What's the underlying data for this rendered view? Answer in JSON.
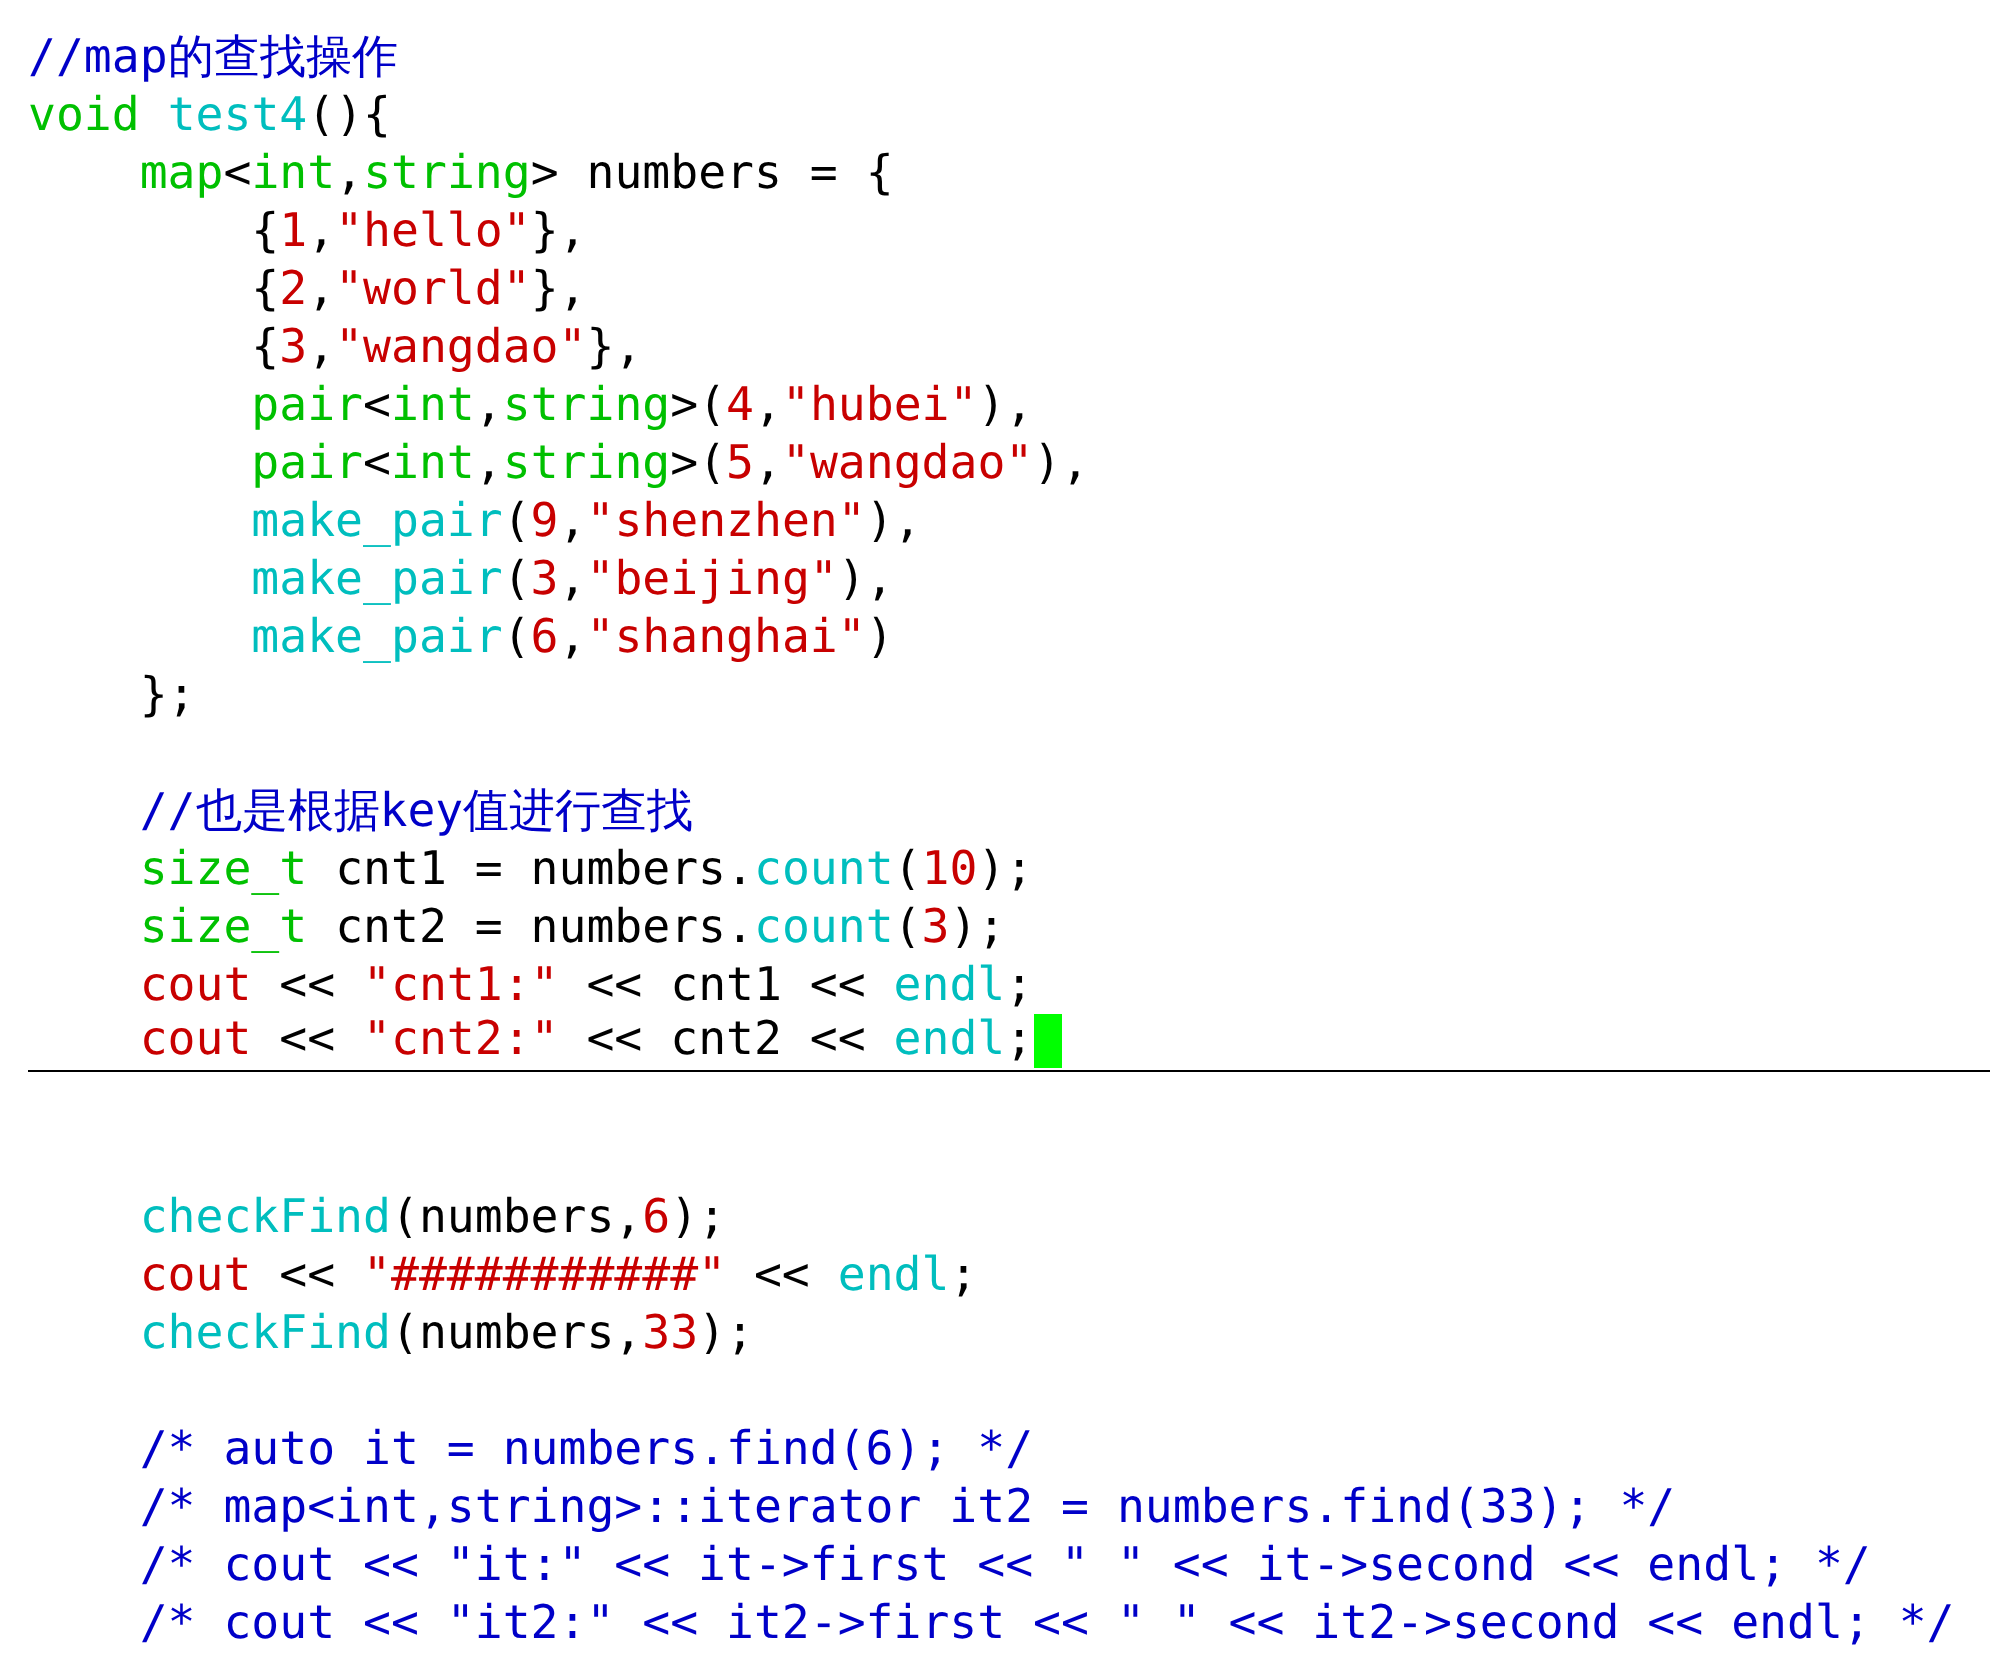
{
  "lines": [
    {
      "kind": "code",
      "cursor_line": false,
      "tokens": [
        {
          "text": "//map的查找操作",
          "kind": "comment"
        }
      ]
    },
    {
      "kind": "code",
      "cursor_line": false,
      "tokens": [
        {
          "text": "void ",
          "kind": "type"
        },
        {
          "text": "test4",
          "kind": "function"
        },
        {
          "text": "(){",
          "kind": "plain"
        }
      ]
    },
    {
      "kind": "code",
      "cursor_line": false,
      "tokens": [
        {
          "text": "    map",
          "kind": "type"
        },
        {
          "text": "<",
          "kind": "plain"
        },
        {
          "text": "int",
          "kind": "type"
        },
        {
          "text": ",",
          "kind": "plain"
        },
        {
          "text": "string",
          "kind": "type"
        },
        {
          "text": "> numbers = {",
          "kind": "plain"
        }
      ]
    },
    {
      "kind": "code",
      "cursor_line": false,
      "tokens": [
        {
          "text": "        {",
          "kind": "plain"
        },
        {
          "text": "1",
          "kind": "number"
        },
        {
          "text": ",",
          "kind": "plain"
        },
        {
          "text": "\"hello\"",
          "kind": "string"
        },
        {
          "text": "},",
          "kind": "plain"
        }
      ]
    },
    {
      "kind": "code",
      "cursor_line": false,
      "tokens": [
        {
          "text": "        {",
          "kind": "plain"
        },
        {
          "text": "2",
          "kind": "number"
        },
        {
          "text": ",",
          "kind": "plain"
        },
        {
          "text": "\"world\"",
          "kind": "string"
        },
        {
          "text": "},",
          "kind": "plain"
        }
      ]
    },
    {
      "kind": "code",
      "cursor_line": false,
      "tokens": [
        {
          "text": "        {",
          "kind": "plain"
        },
        {
          "text": "3",
          "kind": "number"
        },
        {
          "text": ",",
          "kind": "plain"
        },
        {
          "text": "\"wangdao\"",
          "kind": "string"
        },
        {
          "text": "},",
          "kind": "plain"
        }
      ]
    },
    {
      "kind": "code",
      "cursor_line": false,
      "tokens": [
        {
          "text": "        pair",
          "kind": "type"
        },
        {
          "text": "<",
          "kind": "plain"
        },
        {
          "text": "int",
          "kind": "type"
        },
        {
          "text": ",",
          "kind": "plain"
        },
        {
          "text": "string",
          "kind": "type"
        },
        {
          "text": ">(",
          "kind": "plain"
        },
        {
          "text": "4",
          "kind": "number"
        },
        {
          "text": ",",
          "kind": "plain"
        },
        {
          "text": "\"hubei\"",
          "kind": "string"
        },
        {
          "text": "),",
          "kind": "plain"
        }
      ]
    },
    {
      "kind": "code",
      "cursor_line": false,
      "tokens": [
        {
          "text": "        pair",
          "kind": "type"
        },
        {
          "text": "<",
          "kind": "plain"
        },
        {
          "text": "int",
          "kind": "type"
        },
        {
          "text": ",",
          "kind": "plain"
        },
        {
          "text": "string",
          "kind": "type"
        },
        {
          "text": ">(",
          "kind": "plain"
        },
        {
          "text": "5",
          "kind": "number"
        },
        {
          "text": ",",
          "kind": "plain"
        },
        {
          "text": "\"wangdao\"",
          "kind": "string"
        },
        {
          "text": "),",
          "kind": "plain"
        }
      ]
    },
    {
      "kind": "code",
      "cursor_line": false,
      "tokens": [
        {
          "text": "        make_pair",
          "kind": "function"
        },
        {
          "text": "(",
          "kind": "plain"
        },
        {
          "text": "9",
          "kind": "number"
        },
        {
          "text": ",",
          "kind": "plain"
        },
        {
          "text": "\"shenzhen\"",
          "kind": "string"
        },
        {
          "text": "),",
          "kind": "plain"
        }
      ]
    },
    {
      "kind": "code",
      "cursor_line": false,
      "tokens": [
        {
          "text": "        make_pair",
          "kind": "function"
        },
        {
          "text": "(",
          "kind": "plain"
        },
        {
          "text": "3",
          "kind": "number"
        },
        {
          "text": ",",
          "kind": "plain"
        },
        {
          "text": "\"beijing\"",
          "kind": "string"
        },
        {
          "text": "),",
          "kind": "plain"
        }
      ]
    },
    {
      "kind": "code",
      "cursor_line": false,
      "tokens": [
        {
          "text": "        make_pair",
          "kind": "function"
        },
        {
          "text": "(",
          "kind": "plain"
        },
        {
          "text": "6",
          "kind": "number"
        },
        {
          "text": ",",
          "kind": "plain"
        },
        {
          "text": "\"shanghai\"",
          "kind": "string"
        },
        {
          "text": ")",
          "kind": "plain"
        }
      ]
    },
    {
      "kind": "code",
      "cursor_line": false,
      "tokens": [
        {
          "text": "    };",
          "kind": "plain"
        }
      ]
    },
    {
      "kind": "blank",
      "cursor_line": false
    },
    {
      "kind": "code",
      "cursor_line": false,
      "tokens": [
        {
          "text": "    //也是根据key值进行查找",
          "kind": "comment"
        }
      ]
    },
    {
      "kind": "code",
      "cursor_line": false,
      "tokens": [
        {
          "text": "    size_t",
          "kind": "type"
        },
        {
          "text": " cnt1 = numbers.",
          "kind": "plain"
        },
        {
          "text": "count",
          "kind": "function"
        },
        {
          "text": "(",
          "kind": "plain"
        },
        {
          "text": "10",
          "kind": "number"
        },
        {
          "text": ");",
          "kind": "plain"
        }
      ]
    },
    {
      "kind": "code",
      "cursor_line": false,
      "tokens": [
        {
          "text": "    size_t",
          "kind": "type"
        },
        {
          "text": " cnt2 = numbers.",
          "kind": "plain"
        },
        {
          "text": "count",
          "kind": "function"
        },
        {
          "text": "(",
          "kind": "plain"
        },
        {
          "text": "3",
          "kind": "number"
        },
        {
          "text": ");",
          "kind": "plain"
        }
      ]
    },
    {
      "kind": "code",
      "cursor_line": false,
      "tokens": [
        {
          "text": "    cout",
          "kind": "string"
        },
        {
          "text": " << ",
          "kind": "plain"
        },
        {
          "text": "\"cnt1:\"",
          "kind": "string"
        },
        {
          "text": " << cnt1 << ",
          "kind": "plain"
        },
        {
          "text": "endl",
          "kind": "function"
        },
        {
          "text": ";",
          "kind": "plain"
        }
      ]
    },
    {
      "kind": "code",
      "cursor_line": true,
      "tokens": [
        {
          "text": "    cout",
          "kind": "string"
        },
        {
          "text": " << ",
          "kind": "plain"
        },
        {
          "text": "\"cnt2:\"",
          "kind": "string"
        },
        {
          "text": " << cnt2 << ",
          "kind": "plain"
        },
        {
          "text": "endl",
          "kind": "function"
        },
        {
          "text": ";",
          "kind": "plain"
        }
      ]
    },
    {
      "kind": "blank",
      "cursor_line": false
    },
    {
      "kind": "blank",
      "cursor_line": false
    },
    {
      "kind": "code",
      "cursor_line": false,
      "tokens": [
        {
          "text": "    checkFind",
          "kind": "function"
        },
        {
          "text": "(numbers,",
          "kind": "plain"
        },
        {
          "text": "6",
          "kind": "number"
        },
        {
          "text": ");",
          "kind": "plain"
        }
      ]
    },
    {
      "kind": "code",
      "cursor_line": false,
      "tokens": [
        {
          "text": "    cout",
          "kind": "string"
        },
        {
          "text": " << ",
          "kind": "plain"
        },
        {
          "text": "\"###########\"",
          "kind": "string"
        },
        {
          "text": " << ",
          "kind": "plain"
        },
        {
          "text": "endl",
          "kind": "function"
        },
        {
          "text": ";",
          "kind": "plain"
        }
      ]
    },
    {
      "kind": "code",
      "cursor_line": false,
      "tokens": [
        {
          "text": "    checkFind",
          "kind": "function"
        },
        {
          "text": "(numbers,",
          "kind": "plain"
        },
        {
          "text": "33",
          "kind": "number"
        },
        {
          "text": ");",
          "kind": "plain"
        }
      ]
    },
    {
      "kind": "blank",
      "cursor_line": false
    },
    {
      "kind": "code",
      "cursor_line": false,
      "tokens": [
        {
          "text": "    /* auto it = numbers.find(6); */",
          "kind": "comment"
        }
      ]
    },
    {
      "kind": "code",
      "cursor_line": false,
      "tokens": [
        {
          "text": "    /* map<int,string>::iterator it2 = numbers.find(33); */",
          "kind": "comment"
        }
      ]
    },
    {
      "kind": "code",
      "cursor_line": false,
      "tokens": [
        {
          "text": "    /* cout << \"it:\" << it->first << \" \" << it->second << endl; */",
          "kind": "comment"
        }
      ]
    },
    {
      "kind": "code",
      "cursor_line": false,
      "tokens": [
        {
          "text": "    /* cout << \"it2:\" << it2->first << \" \" << it2->second << endl; */",
          "kind": "comment"
        }
      ]
    }
  ]
}
